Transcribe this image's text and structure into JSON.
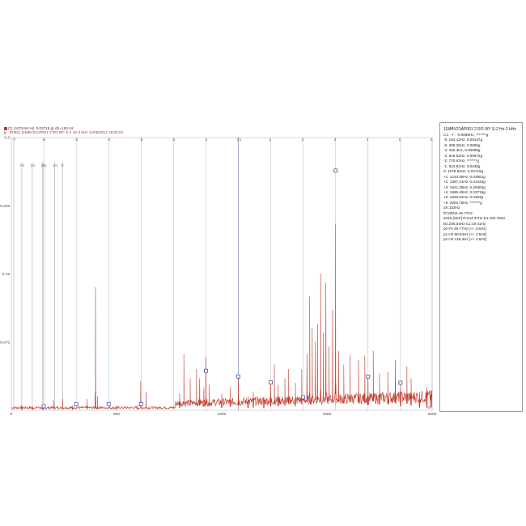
{
  "header": {
    "cursor_readout": "C1 (1078.94 Hz, 0.03719 g)  dX=153 Hz",
    "unit": "g",
    "record": "[RMS]  11MBV21AP001 2 RO 90° S-2 Hz-2 kHz 14/06/2012 15:05:23",
    "series_color": "#c0392b"
  },
  "info_panel": {
    "title": "11MBV21AP001 2 RO 90° S-2 Hz-2 kHz",
    "lines": [
      "C1: -7 : -0.0069Hz, *******g",
      "-6: 154.12Hz, 0.00447g",
      "-5: 308.26Hz, 0.0065g",
      "-4: 462.4Hz, 0.00699g",
      "-3: 616.53Hz, 0.00672g",
      "-2: 770.67Hz, *******g",
      "-1: 924.81Hz, 0.0435g",
      "0: 1078.94Hz, 0.03719g",
      "+1: 1233.08Hz, 0.03061g",
      "+2: 1387.21Hz, 0.01433g",
      "+3: 1541.35Hz, 0.26363g",
      "+4: 1695.49Hz, 0.03715g",
      "+5: 1849.62Hz, 0.0303g",
      "+6: 2003.76Hz, *******g",
      "dX:153Hz",
      "f0:VitRot 49.77Hz",
      "6318 [SKF] R:244.37Hz E1:153.78Hz",
      "B1:206.54Hz C1:19.41Hz",
      "p0 F0 49.77Hz [+/- 2.5Hz]",
      "p1 H2 99.54Hz [+/- 2.5Hz]",
      "p2 H3 149.3Hz [+/- 2.5Hz]"
    ]
  },
  "chart_data": {
    "type": "line",
    "title": "",
    "xlabel": "Hz",
    "ylabel": "g",
    "xlim": [
      0,
      2000
    ],
    "ylim": [
      0,
      0.3
    ],
    "x_ticks": [
      "0",
      "500",
      "1000",
      "1500",
      "2000"
    ],
    "y_ticks": [
      "0.075",
      "0.15",
      "0.225",
      "0.3"
    ],
    "grid": false,
    "series": [
      {
        "color": "#c0392b",
        "peaks": [
          {
            "x": 49.77,
            "y": 0.005
          },
          {
            "x": 99.54,
            "y": 0.004
          },
          {
            "x": 149.3,
            "y": 0.003
          },
          {
            "x": 200,
            "y": 0.011
          },
          {
            "x": 244,
            "y": 0.012
          },
          {
            "x": 290,
            "y": 0.005
          },
          {
            "x": 360,
            "y": 0.012
          },
          {
            "x": 400,
            "y": 0.135
          },
          {
            "x": 410,
            "y": 0.015
          },
          {
            "x": 500,
            "y": 0.005
          },
          {
            "x": 600,
            "y": 0.006
          },
          {
            "x": 615,
            "y": 0.032
          },
          {
            "x": 640,
            "y": 0.02
          },
          {
            "x": 800,
            "y": 0.018
          },
          {
            "x": 820,
            "y": 0.062
          },
          {
            "x": 850,
            "y": 0.035
          },
          {
            "x": 880,
            "y": 0.045
          },
          {
            "x": 895,
            "y": 0.035
          },
          {
            "x": 915,
            "y": 0.025
          },
          {
            "x": 925,
            "y": 0.058
          },
          {
            "x": 940,
            "y": 0.028
          },
          {
            "x": 1000,
            "y": 0.018
          },
          {
            "x": 1040,
            "y": 0.025
          },
          {
            "x": 1079,
            "y": 0.037
          },
          {
            "x": 1125,
            "y": 0.015
          },
          {
            "x": 1150,
            "y": 0.02
          },
          {
            "x": 1200,
            "y": 0.015
          },
          {
            "x": 1233,
            "y": 0.031
          },
          {
            "x": 1250,
            "y": 0.05
          },
          {
            "x": 1268,
            "y": 0.028
          },
          {
            "x": 1300,
            "y": 0.035
          },
          {
            "x": 1318,
            "y": 0.045
          },
          {
            "x": 1350,
            "y": 0.03
          },
          {
            "x": 1380,
            "y": 0.045
          },
          {
            "x": 1405,
            "y": 0.062
          },
          {
            "x": 1418,
            "y": 0.125
          },
          {
            "x": 1430,
            "y": 0.09
          },
          {
            "x": 1445,
            "y": 0.075
          },
          {
            "x": 1455,
            "y": 0.095
          },
          {
            "x": 1470,
            "y": 0.15
          },
          {
            "x": 1482,
            "y": 0.085
          },
          {
            "x": 1495,
            "y": 0.14
          },
          {
            "x": 1510,
            "y": 0.07
          },
          {
            "x": 1527,
            "y": 0.11
          },
          {
            "x": 1541,
            "y": 0.205
          },
          {
            "x": 1555,
            "y": 0.065
          },
          {
            "x": 1580,
            "y": 0.05
          },
          {
            "x": 1610,
            "y": 0.06
          },
          {
            "x": 1650,
            "y": 0.055
          },
          {
            "x": 1680,
            "y": 0.06
          },
          {
            "x": 1695,
            "y": 0.037
          },
          {
            "x": 1720,
            "y": 0.065
          },
          {
            "x": 1750,
            "y": 0.04
          },
          {
            "x": 1790,
            "y": 0.042
          },
          {
            "x": 1825,
            "y": 0.055
          },
          {
            "x": 1850,
            "y": 0.03
          },
          {
            "x": 1880,
            "y": 0.048
          },
          {
            "x": 1900,
            "y": 0.035
          },
          {
            "x": 1940,
            "y": 0.02
          },
          {
            "x": 1975,
            "y": 0.025
          },
          {
            "x": 1995,
            "y": 0.02
          }
        ]
      }
    ],
    "cursor_color": "#7b86c6",
    "harmonic_color": "#9a9a9a",
    "sideband_cursors": [
      {
        "label": "-6",
        "x": 154.12,
        "y": 0.00447
      },
      {
        "label": "-5",
        "x": 308.26,
        "y": 0.0065
      },
      {
        "label": "-4",
        "x": 462.4,
        "y": 0.00699
      },
      {
        "label": "-3",
        "x": 616.53,
        "y": 0.00672
      },
      {
        "label": "-2",
        "x": 770.67,
        "y": null
      },
      {
        "label": "-1",
        "x": 924.81,
        "y": 0.0435
      },
      {
        "label": "C1",
        "x": 1078.94,
        "y": 0.03719
      },
      {
        "label": "1",
        "x": 1233.08,
        "y": 0.03061
      },
      {
        "label": "2",
        "x": 1387.21,
        "y": 0.01433
      },
      {
        "label": "3",
        "x": 1541.35,
        "y": 0.26363
      },
      {
        "label": "4",
        "x": 1695.49,
        "y": 0.03715
      },
      {
        "label": "5",
        "x": 1849.62,
        "y": 0.0303
      },
      {
        "label": "6",
        "x": 2003.76,
        "y": null
      }
    ],
    "left_cursor": {
      "label": "-7",
      "x": 0
    },
    "harmonic_markers": [
      {
        "label": "F0",
        "x": 49.77
      },
      {
        "label": "H2",
        "x": 99.54
      },
      {
        "label": "H3",
        "x": 149.3
      },
      {
        "label": "E1",
        "x": 153.78
      },
      {
        "label": "B1",
        "x": 206.54
      },
      {
        "label": "R",
        "x": 244.37
      }
    ]
  }
}
